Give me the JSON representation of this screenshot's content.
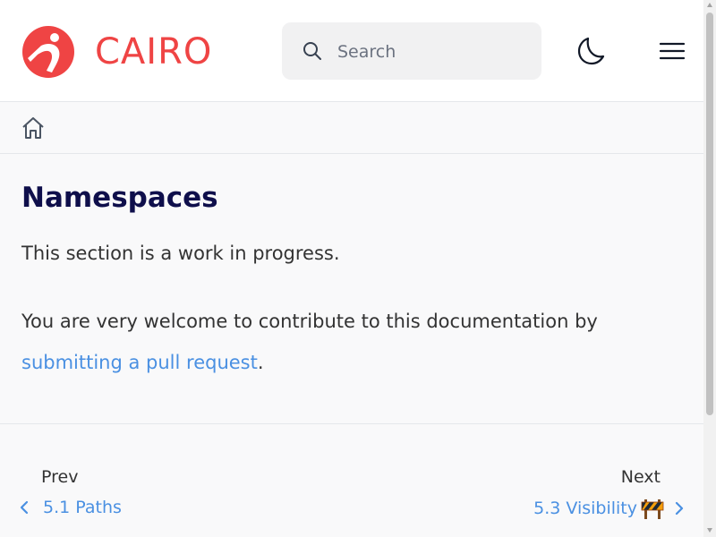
{
  "header": {
    "brand": "CAIRO",
    "search_placeholder": "Search",
    "brand_color": "#ef4444"
  },
  "breadcrumb": {
    "icon": "home-icon"
  },
  "main": {
    "title": "Namespaces",
    "para1": "This section is a work in progress.",
    "para2_text": "You are very welcome to contribute to this documentation by",
    "para2_link": "submitting a pull request",
    "para2_end": "."
  },
  "nav": {
    "prev_label": "Prev",
    "prev_title": "5.1 Paths",
    "next_label": "Next",
    "next_title": "5.3 Visibility",
    "link_color": "#4a90e2"
  },
  "icons": [
    "logo-icon",
    "search-icon",
    "moon-icon",
    "menu-icon",
    "home-icon",
    "chevron-left-icon",
    "chevron-right-icon",
    "construction-barrier-icon"
  ]
}
